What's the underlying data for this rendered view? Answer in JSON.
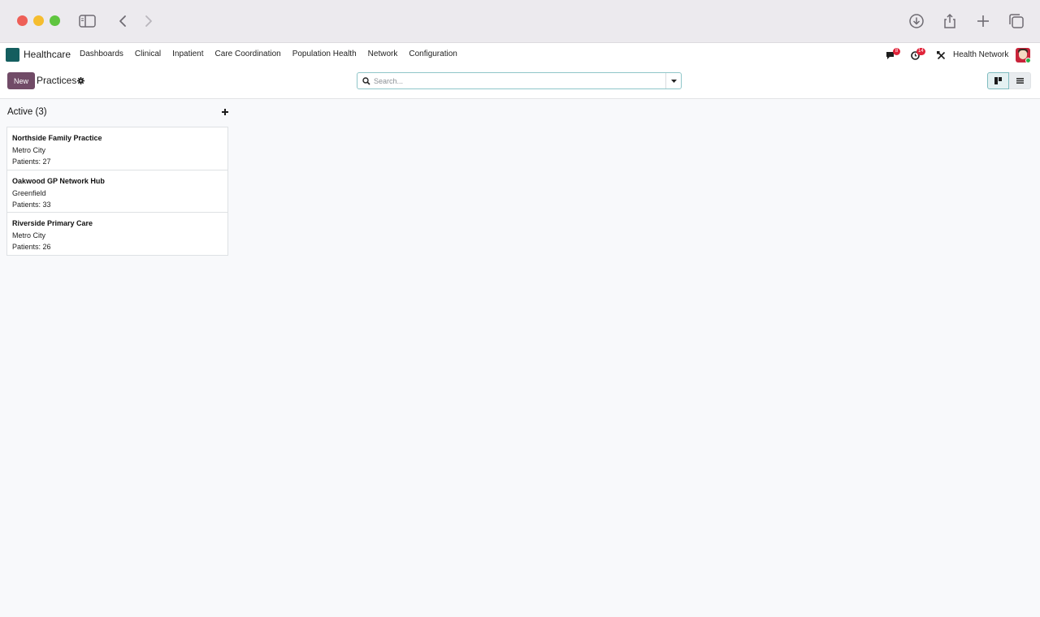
{
  "app": {
    "brand_name": "Healthcare",
    "brand_color": "#145e5f",
    "accent_color": "#714b67",
    "menu": [
      "Dashboards",
      "Clinical",
      "Inpatient",
      "Care Coordination",
      "Population Health",
      "Network",
      "Configuration"
    ],
    "messages_count": "8",
    "activities_count": "14",
    "company_name": "Health Network"
  },
  "browser": {
    "icons": [
      "sidebar-toggle-icon",
      "back-icon",
      "forward-icon",
      "download-icon",
      "share-icon",
      "new-tab-icon",
      "tab-overview-icon"
    ]
  },
  "control_panel": {
    "new_label": "New",
    "title": "Practices",
    "search_placeholder": "Search..."
  },
  "kanban": {
    "column_title": "Active (3)",
    "cards": [
      {
        "name": "Northside Family Practice",
        "city": "Metro City",
        "patients": "Patients: 27"
      },
      {
        "name": "Oakwood GP Network Hub",
        "city": "Greenfield",
        "patients": "Patients: 33"
      },
      {
        "name": "Riverside Primary Care",
        "city": "Metro City",
        "patients": "Patients: 26"
      }
    ]
  }
}
